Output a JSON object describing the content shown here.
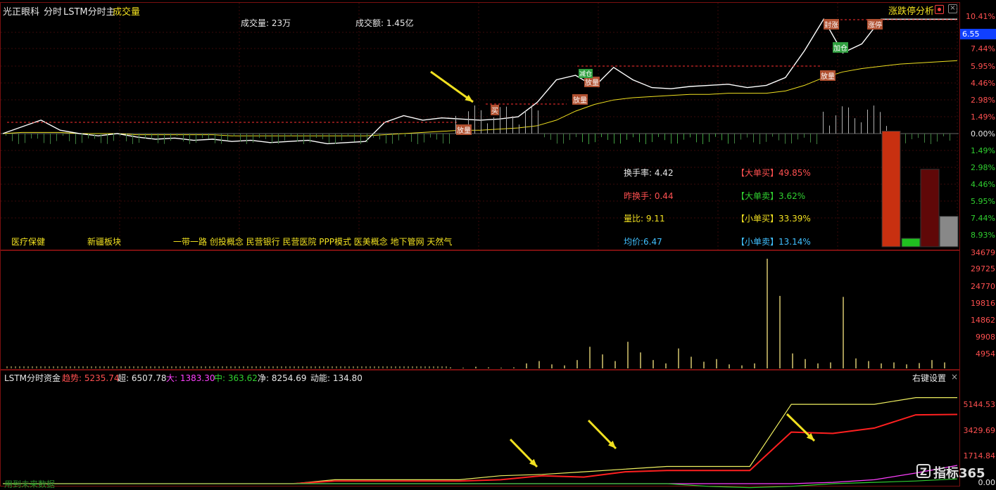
{
  "header": {
    "stock_name": "光正眼科",
    "mode": "分时",
    "indicator": "LSTM分时主",
    "volume_label": "成交量",
    "right_tool": "涨跌停分析"
  },
  "price_axis": {
    "current_price": "6.55",
    "up_labels": [
      "10.41%",
      "7.44%",
      "5.95%",
      "4.46%",
      "2.98%",
      "1.49%",
      "0.00%"
    ],
    "down_labels": [
      "1.49%",
      "2.98%",
      "4.46%",
      "5.95%",
      "7.44%",
      "8.93%"
    ]
  },
  "summary": {
    "volume": "成交量: 23万",
    "amount": "成交额: 1.45亿"
  },
  "stats": {
    "turnover": "换手率: 4.42",
    "prev_turnover": "昨换手: 0.44",
    "volume_ratio": "量比: 9.11",
    "avg_price": "均价:6.47",
    "big_buy": "【大单买】49.85%",
    "big_sell": "【大单卖】3.62%",
    "small_buy": "【小单买】33.39%",
    "small_sell": "【小单卖】13.14%"
  },
  "sectors": [
    "医疗保健",
    "新疆板块",
    "一带一路 创投概念 民营银行 民营医院 PPP模式 医美概念 地下管网 天然气"
  ],
  "chart_markers": {
    "m1": "放量",
    "m2": "买",
    "m3": "放量",
    "m4": "放量",
    "m5": "加仓",
    "m6": "放量",
    "m7": "封涨",
    "m8": "涨停",
    "m9": "减仓"
  },
  "volume_axis": [
    "34679",
    "29725",
    "24770",
    "19816",
    "14862",
    "9908",
    "4954"
  ],
  "capital_panel": {
    "title": "LSTM分时资金",
    "trend": "趋势: 5235.74",
    "super": "超: 6507.78",
    "big": "大: 1383.30",
    "mid": "中: 363.62",
    "net": "净: 8254.69",
    "momentum": "动能: 134.80",
    "settings": "右键设置",
    "close": "×",
    "axis": [
      "5144.53",
      "3429.69",
      "1714.84",
      "0.00"
    ],
    "footer": "用到未来数据"
  },
  "watermark": "指标365",
  "colors": {
    "up": "#ff3030",
    "down": "#30d030",
    "price_line": "#ffffff",
    "avg_line": "#f0e020",
    "border": "#7a1010"
  },
  "chart_data": [
    {
      "type": "line",
      "title": "",
      "series": [
        {
          "name": "",
          "values_pct": [
            0,
            0.6,
            1.2,
            0.3,
            0,
            -0.2,
            0,
            -0.3,
            -0.5,
            -0.4,
            -0.6,
            -0.5,
            -0.7,
            -0.6,
            -0.8,
            -0.7,
            -0.6,
            -0.9,
            -0.8,
            -0.7,
            1.0,
            1.6,
            1.2,
            1.4,
            1.3,
            1.2,
            1.3,
            1.5,
            2.8,
            4.8,
            5.2,
            4.2,
            5.9,
            4.8,
            4.1,
            4.0,
            4.2,
            4.3,
            4.4,
            4.1,
            4.3,
            5.0,
            7.4,
            10.2,
            7.2,
            8.0,
            10.2,
            10.2,
            10.2,
            10.2,
            10.2
          ]
        },
        {
          "name": "",
          "values_pct": [
            0,
            0.1,
            0.1,
            0.1,
            0,
            0,
            0,
            -0.1,
            -0.1,
            -0.1,
            -0.1,
            -0.1,
            -0.2,
            -0.2,
            -0.2,
            -0.2,
            -0.2,
            -0.2,
            -0.2,
            -0.2,
            -0.1,
            0,
            0.1,
            0.2,
            0.3,
            0.3,
            0.4,
            0.5,
            0.7,
            1.2,
            2.0,
            2.6,
            3.0,
            3.2,
            3.3,
            3.4,
            3.5,
            3.5,
            3.6,
            3.6,
            3.6,
            3.8,
            4.3,
            5.0,
            5.5,
            5.8,
            6.0,
            6.2,
            6.3,
            6.4,
            6.5
          ]
        }
      ]
    },
    {
      "type": "bar",
      "categories": [
        "大单买",
        "大单卖",
        "小单买",
        "小单卖"
      ],
      "values": [
        49.85,
        3.62,
        33.39,
        13.14
      ]
    },
    {
      "type": "bar",
      "title": "",
      "values": [
        300,
        200,
        500,
        300,
        200,
        300,
        1500,
        2200,
        1200,
        900,
        2500,
        6500,
        4200,
        2200,
        8000,
        4800,
        2500,
        1500,
        6000,
        3500,
        2000,
        2800,
        1200,
        900,
        1500,
        33000,
        21800,
        4500,
        2800,
        1500,
        1800,
        21500,
        3000,
        2200,
        1500,
        1800,
        1200,
        1600,
        2500,
        1800
      ]
    },
    {
      "type": "line",
      "series": [
        {
          "name": "超",
          "values": [
            0,
            0,
            0,
            0,
            0,
            0,
            0,
            0,
            300,
            300,
            300,
            300,
            600,
            700,
            900,
            1100,
            1300,
            1300,
            1300,
            6000,
            6000,
            6000,
            6500,
            6500
          ]
        },
        {
          "name": "趋势",
          "values": [
            0,
            0,
            0,
            0,
            0,
            0,
            0,
            0,
            200,
            200,
            200,
            200,
            300,
            600,
            500,
            900,
            1000,
            1000,
            1000,
            3900,
            3800,
            4200,
            5200,
            5235
          ]
        },
        {
          "name": "大",
          "values": [
            0,
            0,
            0,
            0,
            0,
            0,
            0,
            0,
            0,
            0,
            0,
            0,
            0,
            0,
            0,
            0,
            0,
            0,
            0,
            0,
            100,
            300,
            800,
            1383
          ]
        },
        {
          "name": "中",
          "values": [
            0,
            0,
            0,
            0,
            0,
            0,
            0,
            0,
            0,
            0,
            0,
            0,
            0,
            0,
            0,
            0,
            0,
            -200,
            -300,
            -200,
            0,
            100,
            200,
            363
          ]
        }
      ]
    }
  ]
}
